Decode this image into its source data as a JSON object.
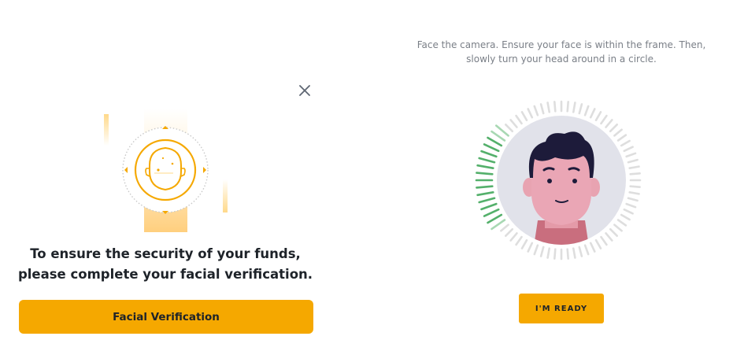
{
  "modal": {
    "close_icon": "close-icon",
    "illustration_icon": "face-scan-icon",
    "headline": "To ensure the security of your funds, please complete your facial verification.",
    "primary_button_label": "Facial Verification",
    "accent_color": "#f5a800"
  },
  "camera_step": {
    "instructions": "Face the camera. Ensure your face is within the frame. Then, slowly turn your head around in a circle.",
    "ready_button_label": "I'M READY",
    "illustration_icon": "face-avatar-icon",
    "progress_color": "#54b06b",
    "track_color": "#dedede"
  }
}
